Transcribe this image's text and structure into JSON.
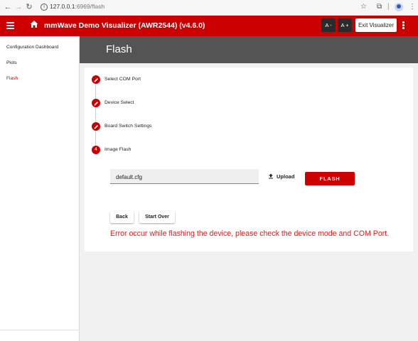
{
  "browser": {
    "back_icon": "←",
    "forward_icon": "→",
    "reload_icon": "↻",
    "url_host": "127.0.0.1",
    "url_path": ":6969/flash",
    "bookmark_icon": "☆",
    "extensions_icon": "⧉",
    "separator": "|",
    "kebab_icon": "⋮"
  },
  "header": {
    "title": "mmWave Demo Visualizer (AWR2544) (v4.6.0)",
    "font_decrease": "A -",
    "font_increase": "A +",
    "exit_label": "Exit Visualizer",
    "brand_color": "#cc0000"
  },
  "sidebar": {
    "items": [
      {
        "label": "Configuration Dashboard"
      },
      {
        "label": "Plots"
      },
      {
        "label": "Flash"
      }
    ],
    "active_color": "#cc0000"
  },
  "page": {
    "title": "Flash"
  },
  "steps": [
    {
      "label": "Select COM Port",
      "icon": "edit-icon"
    },
    {
      "label": "Device Select",
      "icon": "edit-icon"
    },
    {
      "label": "Board Switch Settings",
      "icon": "edit-icon"
    },
    {
      "label": "Image Flash",
      "number": "4"
    }
  ],
  "flash_form": {
    "file_value": "default.cfg",
    "upload_label": "Upload",
    "flash_label": "FLASH",
    "back_label": "Back",
    "start_over_label": "Start Over",
    "error_message": "Error occur while flashing the device, please check the device mode and COM Port.",
    "error_color": "#dd1f1f"
  }
}
